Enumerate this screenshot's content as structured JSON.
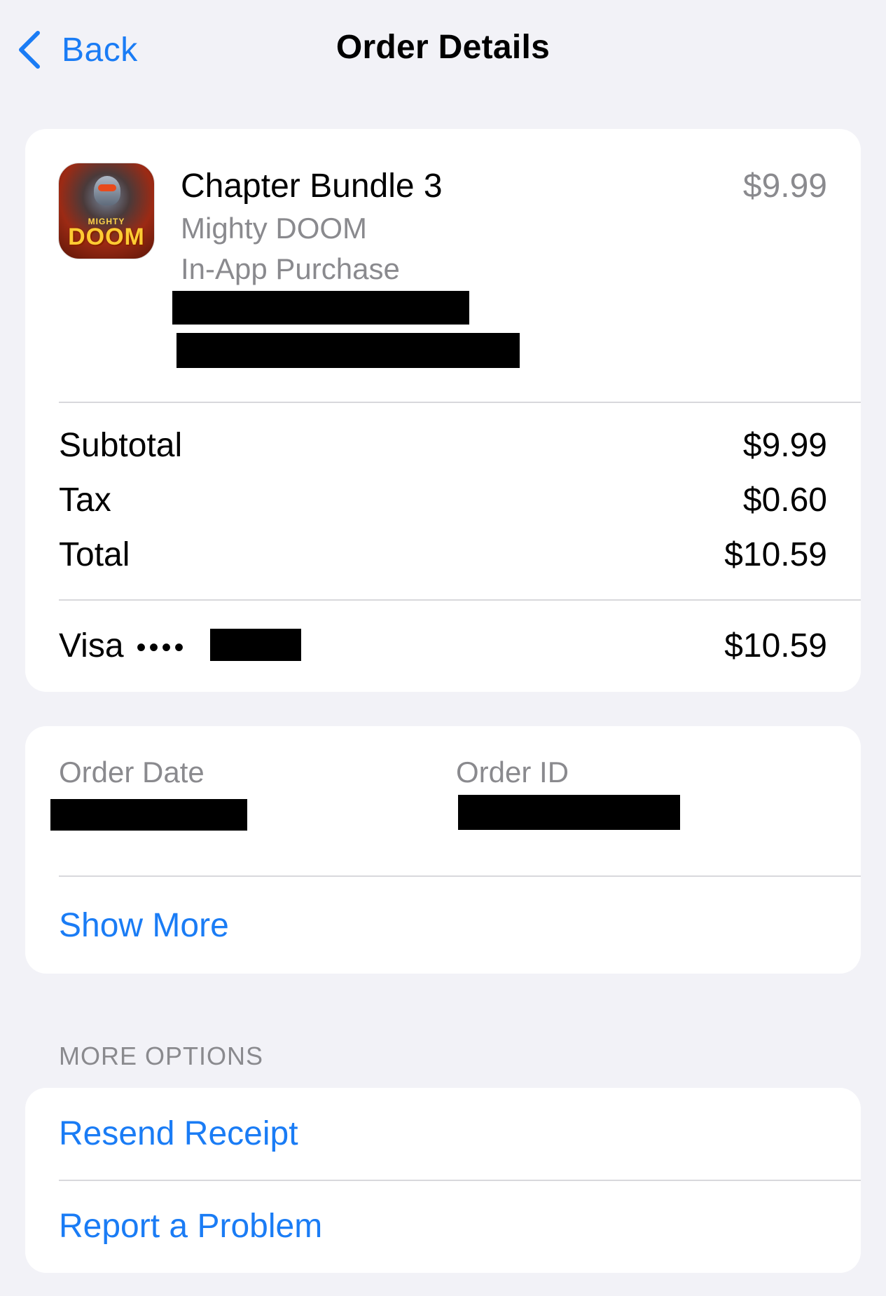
{
  "nav": {
    "back_label": "Back",
    "title": "Order Details"
  },
  "item": {
    "title": "Chapter Bundle 3",
    "app_name": "Mighty DOOM",
    "purchase_type": "In-App Purchase",
    "price": "$9.99",
    "icon": "mighty-doom-app-icon",
    "icon_brand_small": "MIGHTY",
    "icon_brand_large": "DOOM"
  },
  "summary": {
    "subtotal_label": "Subtotal",
    "subtotal_value": "$9.99",
    "tax_label": "Tax",
    "tax_value": "$0.60",
    "total_label": "Total",
    "total_value": "$10.59"
  },
  "payment": {
    "method_label": "Visa",
    "masked_dots": "••••",
    "amount": "$10.59"
  },
  "order": {
    "date_label": "Order Date",
    "id_label": "Order ID",
    "show_more_label": "Show More"
  },
  "more_options": {
    "header": "MORE OPTIONS",
    "resend_receipt_label": "Resend Receipt",
    "report_problem_label": "Report a Problem"
  },
  "colors": {
    "background": "#f2f2f7",
    "card": "#ffffff",
    "accent": "#1a7cf5",
    "secondary_text": "#8a8a8e",
    "redaction": "#000000"
  }
}
